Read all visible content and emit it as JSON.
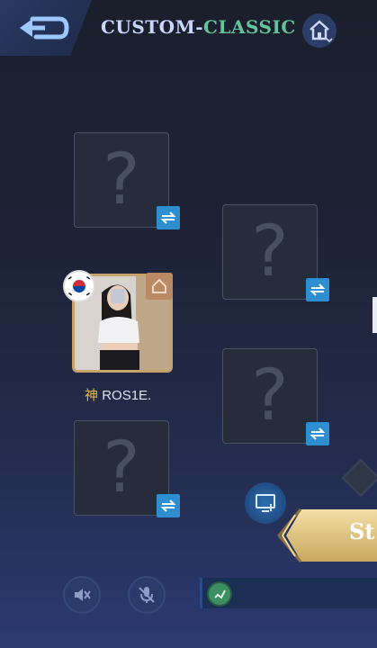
{
  "header": {
    "title_part1": "CUSTOM-",
    "title_part2": "CLASSIC"
  },
  "player": {
    "name_prefix": "神",
    "name": "ROS1E.",
    "country_flag": "south-korea-flag-icon"
  },
  "slots": {
    "empty_symbol": "?"
  },
  "footer": {
    "start_label": "St"
  },
  "colors": {
    "title_primary": "#c9d6ff",
    "title_accent": "#63c39a",
    "card_border": "#c6a26d",
    "swap_button": "#2d8ed0",
    "start_button": "#e8d08f"
  },
  "icons": {
    "back": "back-arrow-icon",
    "home": "home-icon",
    "swap": "swap-icon",
    "owner": "home-icon",
    "speaker_muted": "speaker-mute-icon",
    "mic_muted": "mic-mute-icon",
    "spectate": "monitor-add-icon",
    "chat": "chat-icon"
  }
}
